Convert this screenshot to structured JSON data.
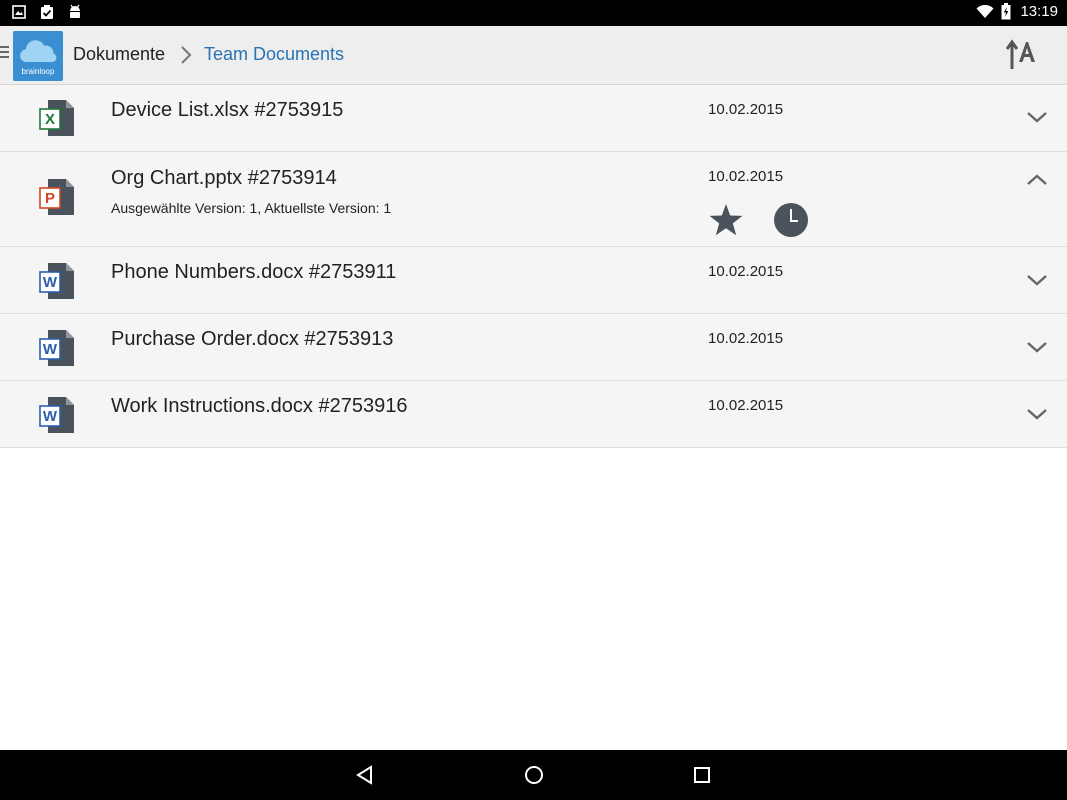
{
  "status_bar": {
    "time": "13:19",
    "left_icons": [
      "gallery-icon",
      "clipboard-check-icon",
      "android-debug-icon"
    ],
    "right_icons": [
      "wifi-icon",
      "battery-charging-icon"
    ]
  },
  "app_bar": {
    "logo_text": "brainloop",
    "breadcrumb": {
      "root": "Dokumente",
      "current": "Team Documents"
    },
    "sort_icon": "sort-alpha-icon"
  },
  "files": [
    {
      "name": "Device List.xlsx #2753915",
      "date": "10.02.2015",
      "type": "excel",
      "type_letter": "X",
      "expanded": false
    },
    {
      "name": "Org Chart.pptx #2753914",
      "date": "10.02.2015",
      "type": "powerpoint",
      "type_letter": "P",
      "expanded": true,
      "subtitle": "Ausgewählte Version: 1, Aktuellste Version: 1"
    },
    {
      "name": "Phone Numbers.docx #2753911",
      "date": "10.02.2015",
      "type": "word",
      "type_letter": "W",
      "expanded": false
    },
    {
      "name": "Purchase Order.docx #2753913",
      "date": "10.02.2015",
      "type": "word",
      "type_letter": "W",
      "expanded": false
    },
    {
      "name": "Work Instructions.docx #2753916",
      "date": "10.02.2015",
      "type": "word",
      "type_letter": "W",
      "expanded": false
    }
  ],
  "colors": {
    "accent": "#2a72b5",
    "logo_bg": "#3a8fd2",
    "excel": "#1f7a3a",
    "powerpoint": "#d24726",
    "word": "#2b5fad",
    "icon_dark": "#4a535c"
  },
  "nav_bar": {
    "buttons": [
      "back-icon",
      "home-icon",
      "recents-icon"
    ]
  }
}
